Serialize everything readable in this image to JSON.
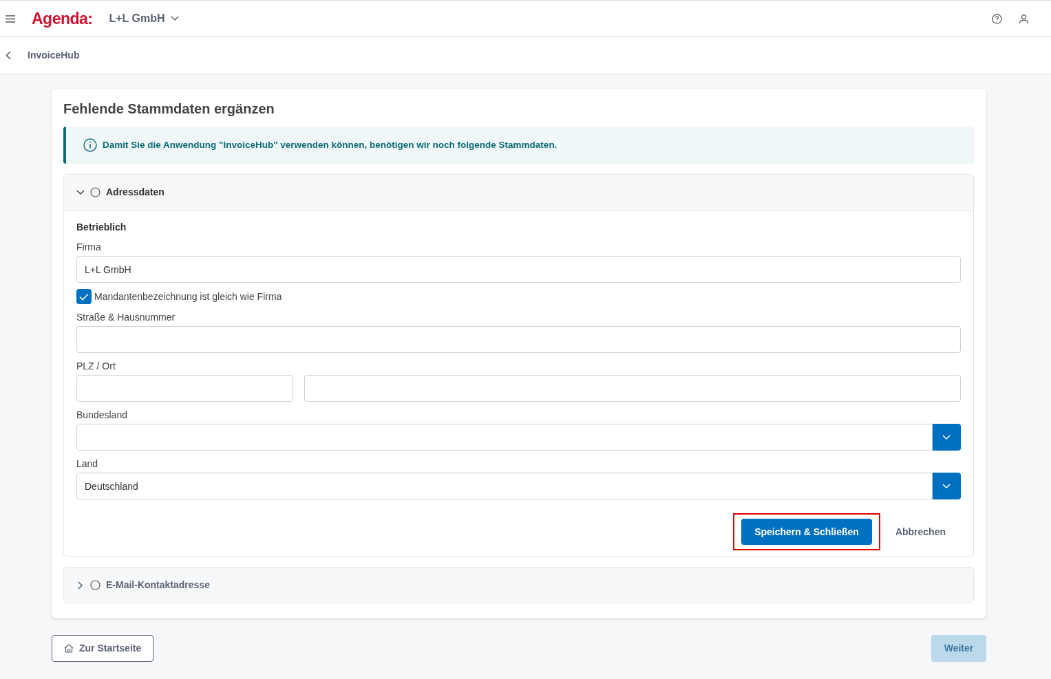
{
  "header": {
    "logo": "Agenda:",
    "company": "L+L GmbH"
  },
  "breadcrumb": {
    "title": "InvoiceHub"
  },
  "page": {
    "title": "Fehlende Stammdaten ergänzen",
    "info": "Damit Sie die Anwendung \"InvoiceHub\" verwenden können, benötigen wir noch folgende Stammdaten."
  },
  "sections": [
    {
      "title": "Adressdaten",
      "expanded": true,
      "subheading": "Betrieblich",
      "fields": [
        {
          "kind": "text",
          "label": "Firma",
          "value": "L+L GmbH"
        },
        {
          "kind": "checkbox",
          "label": "Mandantenbezeichnung ist gleich wie Firma",
          "checked": true
        },
        {
          "kind": "text",
          "label": "Straße & Hausnummer"
        },
        {
          "kind": "pair",
          "label": "PLZ / Ort"
        },
        {
          "kind": "select",
          "label": "Bundesland"
        },
        {
          "kind": "select",
          "label": "Land",
          "value": "Deutschland"
        }
      ],
      "save": {
        "label": "Speichern & Schließen",
        "highlighted": true
      },
      "cancel": "Abbrechen"
    },
    {
      "title": "E-Mail-Kontaktadresse",
      "expanded": false
    }
  ],
  "footer": {
    "home": "Zur Startseite",
    "next": {
      "label": "Weiter",
      "disabled": true
    }
  }
}
